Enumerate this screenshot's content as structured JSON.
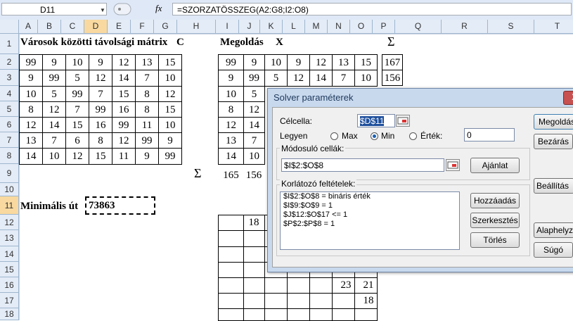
{
  "formula_bar": {
    "cell_ref": "D11",
    "fx_label": "fx",
    "formula": "=SZORZATÖSSZEG(A2:G8;I2:O8)"
  },
  "columns": [
    "A",
    "B",
    "C",
    "D",
    "E",
    "F",
    "G",
    "H",
    "I",
    "J",
    "K",
    "L",
    "M",
    "N",
    "O",
    "P",
    "Q",
    "R",
    "S",
    "T"
  ],
  "rows": [
    "1",
    "2",
    "3",
    "4",
    "5",
    "6",
    "7",
    "8",
    "9",
    "10",
    "11",
    "12",
    "13",
    "14",
    "15",
    "16",
    "17",
    "18"
  ],
  "selected": {
    "column": "D",
    "row": "11"
  },
  "sheet": {
    "distance_title": "Városok közötti távolsági mátrix",
    "distance_title_suffix": "C",
    "solution_title": "Megoldás",
    "solution_title_suffix": "X",
    "sum_symbol": "Σ",
    "matrix_c": [
      [
        "99",
        "9",
        "10",
        "9",
        "12",
        "13",
        "15"
      ],
      [
        "9",
        "99",
        "5",
        "12",
        "14",
        "7",
        "10"
      ],
      [
        "10",
        "5",
        "99",
        "7",
        "15",
        "8",
        "12"
      ],
      [
        "8",
        "12",
        "7",
        "99",
        "16",
        "8",
        "15"
      ],
      [
        "12",
        "14",
        "15",
        "16",
        "99",
        "11",
        "10"
      ],
      [
        "13",
        "7",
        "6",
        "8",
        "12",
        "99",
        "9"
      ],
      [
        "14",
        "10",
        "12",
        "15",
        "11",
        "9",
        "99"
      ]
    ],
    "matrix_x_visible": [
      [
        "99",
        "9",
        "10",
        "9",
        "12",
        "13",
        "15"
      ],
      [
        "9",
        "99",
        "5",
        "12",
        "14",
        "7",
        "10"
      ],
      [
        "10",
        "5"
      ],
      [
        "8",
        "12"
      ],
      [
        "12",
        "14"
      ],
      [
        "13",
        "7"
      ],
      [
        "14",
        "10"
      ]
    ],
    "p_column": [
      "167",
      "156"
    ],
    "row9_values": [
      "165",
      "156"
    ],
    "min_label": "Minimális út",
    "min_value": "73863",
    "lower_values": {
      "j12": "18",
      "n16": "23",
      "o16": "21",
      "o17": "18"
    }
  },
  "dialog": {
    "title": "Solver paraméterek",
    "close_glyph": "X",
    "target_label": "Célcella:",
    "target_value": "$D$11",
    "equal_label": "Legyen",
    "opt_max": "Max",
    "opt_min": "Min",
    "opt_value": "Érték:",
    "value_input": "0",
    "changing_label": "Módosuló cellák:",
    "changing_value": "$I$2:$O$8",
    "suggest_button": "Ajánlat",
    "constraints_label": "Korlátozó feltételek:",
    "constraints": [
      "$I$2:$O$8 = bináris érték",
      "$I$9:$O$9 = 1",
      "$J$12:$O$17 <= 1",
      "$P$2:$P$8 = 1"
    ],
    "add_button": "Hozzáadás",
    "change_button": "Szerkesztés",
    "delete_button": "Törlés",
    "solve_button": "Megoldás",
    "close_button": "Bezárás",
    "options_button": "Beállítás",
    "reset_button": "Alaphelyzet",
    "help_button": "Súgó"
  }
}
